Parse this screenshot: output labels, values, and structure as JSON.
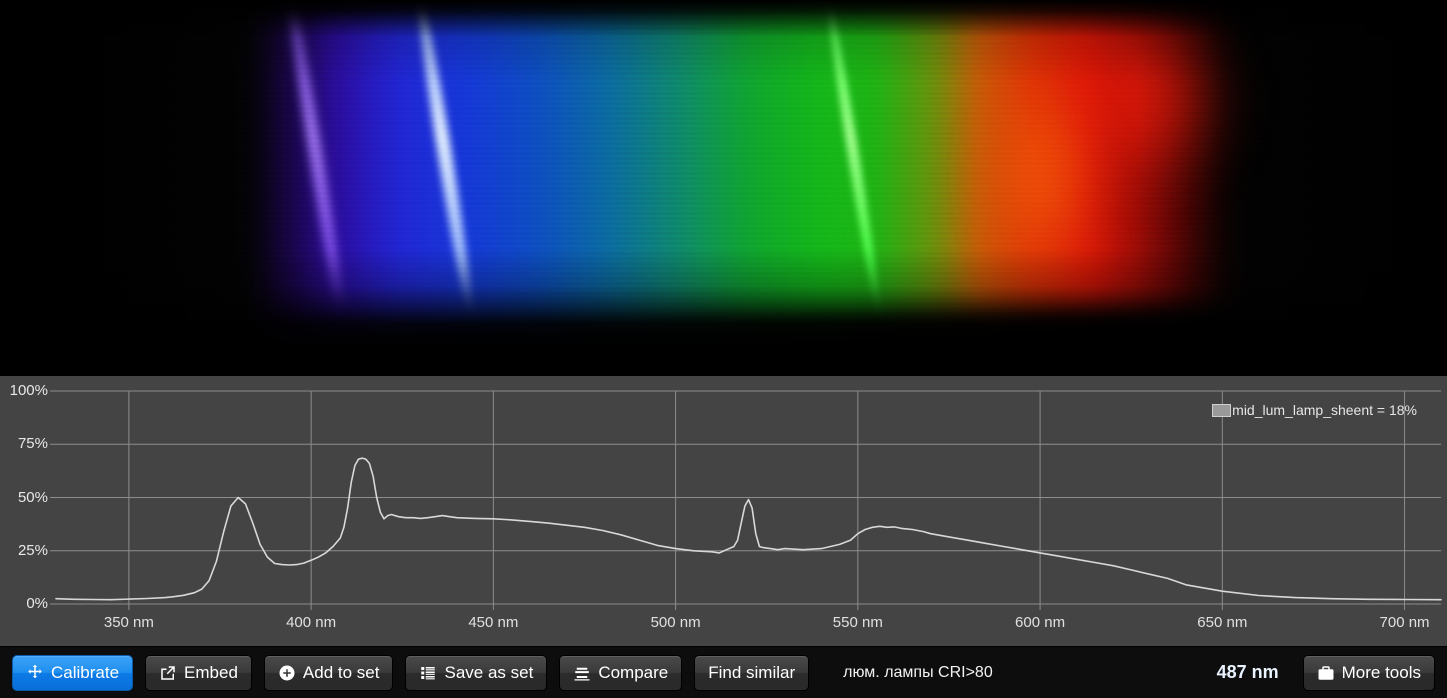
{
  "spectrum_image": {
    "alt": "emission-spectrum-photograph",
    "description": "photographed diffraction spectrum of a fluorescent lamp with discrete violet, blue and green mercury emission lines over a continuous phosphor band"
  },
  "chart_data": {
    "type": "line",
    "title": "",
    "xlabel": "",
    "ylabel": "",
    "xlim": [
      330,
      710
    ],
    "ylim": [
      0,
      100
    ],
    "grid": true,
    "legend_position": "top-right",
    "legend": [
      {
        "label": "mid_lum_lamp_sheent = 18%",
        "color": "#9a9a9a"
      }
    ],
    "x_tick_labels": [
      "350 nm",
      "400 nm",
      "450 nm",
      "500 nm",
      "550 nm",
      "600 nm",
      "650 nm",
      "700 nm"
    ],
    "x_ticks": [
      350,
      400,
      450,
      500,
      550,
      600,
      650,
      700
    ],
    "y_tick_labels": [
      "0%",
      "25%",
      "50%",
      "75%",
      "100%"
    ],
    "y_ticks": [
      0,
      25,
      50,
      75,
      100
    ],
    "series": [
      {
        "name": "mid_lum_lamp_sheent",
        "color": "#d8d8d8",
        "x": [
          330,
          335,
          340,
          345,
          350,
          355,
          360,
          362,
          365,
          368,
          370,
          372,
          374,
          376,
          378,
          380,
          382,
          384,
          386,
          388,
          390,
          392,
          394,
          396,
          398,
          400,
          402,
          404,
          406,
          408,
          409,
          410,
          411,
          412,
          413,
          414,
          415,
          416,
          417,
          418,
          419,
          420,
          421,
          422,
          424,
          426,
          428,
          430,
          432,
          434,
          436,
          438,
          440,
          445,
          450,
          455,
          460,
          465,
          470,
          475,
          480,
          485,
          490,
          495,
          500,
          505,
          510,
          512,
          514,
          516,
          517,
          518,
          519,
          520,
          521,
          522,
          523,
          524,
          526,
          528,
          530,
          535,
          540,
          545,
          548,
          550,
          552,
          554,
          556,
          558,
          560,
          562,
          565,
          568,
          570,
          575,
          580,
          585,
          590,
          595,
          600,
          605,
          610,
          615,
          620,
          625,
          630,
          635,
          640,
          650,
          660,
          670,
          680,
          690,
          700,
          710
        ],
        "y": [
          2.5,
          2.2,
          2.1,
          2.0,
          2.3,
          2.6,
          3.0,
          3.4,
          4.1,
          5.3,
          7.0,
          11,
          20,
          34,
          46,
          50,
          47,
          38,
          28,
          22,
          19,
          18.5,
          18.3,
          18.5,
          19.2,
          20.5,
          22,
          24,
          27,
          31,
          36,
          45,
          57,
          65,
          68,
          68.5,
          68,
          66,
          60,
          50,
          43,
          40,
          41.5,
          42,
          41,
          40.5,
          40.5,
          40.2,
          40.5,
          41,
          41.5,
          41,
          40.5,
          40.2,
          40,
          39.5,
          38.8,
          38,
          37,
          36,
          34.5,
          32.5,
          30,
          27.5,
          26,
          25,
          24.5,
          24,
          25.5,
          27,
          30,
          38,
          46,
          49,
          45,
          33,
          27,
          26.5,
          26,
          25.5,
          26,
          25.5,
          26,
          28,
          30,
          33,
          35,
          36,
          36.5,
          36,
          36.2,
          35.5,
          35,
          34,
          33,
          31.5,
          30,
          28.5,
          27,
          25.5,
          24,
          22.5,
          21,
          19.5,
          18,
          16,
          14,
          12,
          9,
          6,
          4,
          3,
          2.5,
          2.2,
          2.1,
          2.0,
          2.0
        ]
      }
    ]
  },
  "legend_entry": {
    "text": "mid_lum_lamp_sheent = 18%"
  },
  "toolbar": {
    "buttons": [
      {
        "id": "calibrate",
        "label": "Calibrate",
        "icon": "move-crosshair-icon",
        "primary": true
      },
      {
        "id": "embed",
        "label": "Embed",
        "icon": "share-export-icon",
        "primary": false
      },
      {
        "id": "add-to-set",
        "label": "Add to set",
        "icon": "plus-circle-icon",
        "primary": false
      },
      {
        "id": "save-as-set",
        "label": "Save as set",
        "icon": "list-icon",
        "primary": false
      },
      {
        "id": "compare",
        "label": "Compare",
        "icon": "bars-icon",
        "primary": false
      },
      {
        "id": "find-similar",
        "label": "Find similar",
        "icon": "none",
        "primary": false
      }
    ],
    "lamp_name": "люм. лампы CRI>80",
    "wavelength_readout": "487 nm",
    "more_tools": {
      "label": "More tools",
      "icon": "briefcase-icon"
    }
  },
  "colors": {
    "accent_blue": "#0c7ae6",
    "chart_background": "#444444",
    "toolbar_background": "#0d0d0d",
    "curve": "#d8d8d8",
    "gridline": "#8d8d8d",
    "text": "#e8e8e8",
    "wavelength_text": "#e9f3ff"
  }
}
